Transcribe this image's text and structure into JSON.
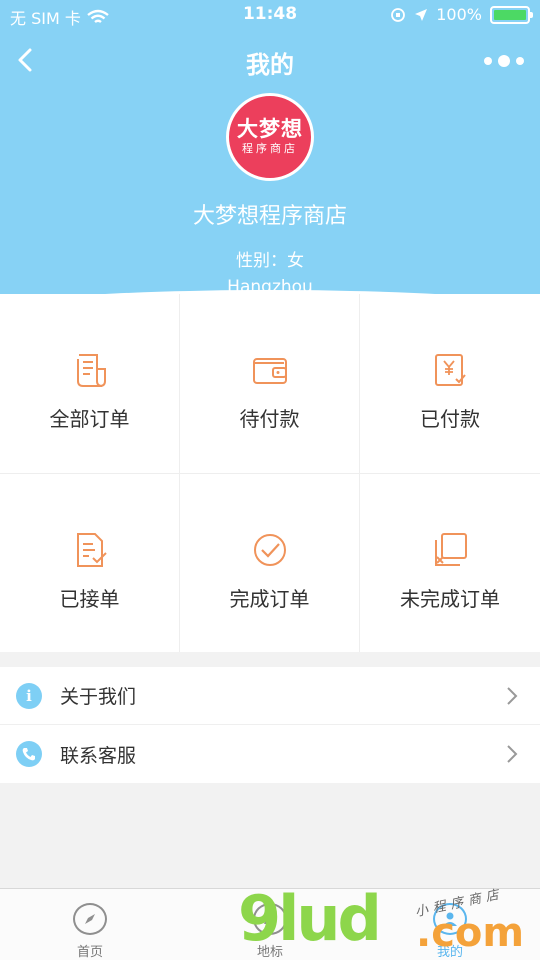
{
  "status_bar": {
    "carrier": "无 SIM 卡",
    "time": "11:48",
    "battery": "100%"
  },
  "nav": {
    "title": "我的"
  },
  "profile": {
    "avatar_line1": "大梦想",
    "avatar_line2": "程序商店",
    "name": "大梦想程序商店",
    "gender": "性别：女",
    "city": "Hangzhou"
  },
  "orders": [
    {
      "label": "全部订单",
      "icon": "receipt-icon"
    },
    {
      "label": "待付款",
      "icon": "wallet-icon"
    },
    {
      "label": "已付款",
      "icon": "paid-bill-icon"
    },
    {
      "label": "已接单",
      "icon": "document-check-icon"
    },
    {
      "label": "完成订单",
      "icon": "check-circle-icon"
    },
    {
      "label": "未完成订单",
      "icon": "stacked-cancel-icon"
    }
  ],
  "menu": [
    {
      "label": "关于我们",
      "icon": "info-icon"
    },
    {
      "label": "联系客服",
      "icon": "phone-icon"
    }
  ],
  "tabbar": [
    {
      "label": "首页",
      "icon": "compass-icon"
    },
    {
      "label": "地标",
      "icon": "landmark-icon"
    },
    {
      "label": "我的",
      "icon": "user-icon"
    }
  ],
  "watermark": {
    "main": "9lud",
    "domain": ".com",
    "sub": "小程序商店"
  },
  "colors": {
    "header_bg": "#87d2f5",
    "accent_orange": "#f0935a",
    "avatar_red": "#ec3f5c",
    "list_icon_blue": "#7ecff5"
  }
}
